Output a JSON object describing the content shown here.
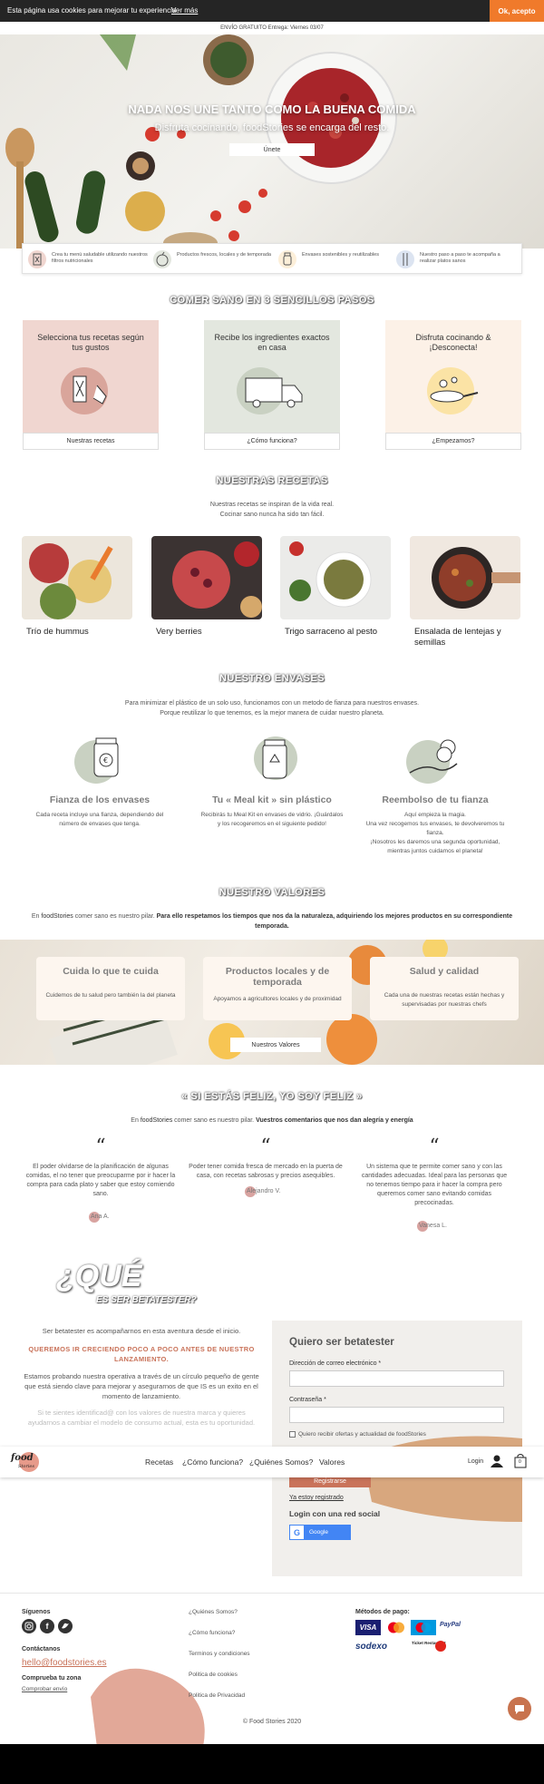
{
  "cookie": {
    "text": "Esta página usa cookies para mejorar tu experiencia",
    "link": "Ver más",
    "accept": "Ok, acepto"
  },
  "shipping": "ENVÍO GRATUITO Entrega: Viernes 03/07",
  "hero": {
    "title": "NADA NOS UNE TANTO COMO LA BUENA COMIDA",
    "subtitle": "Disfruta cocinando, foodStories se encarga del resto.",
    "button": "Únete"
  },
  "features": [
    {
      "text": "Crea tu menú saludable utilizando nuestros filtros nutricionales",
      "icon": "menu-filter-icon"
    },
    {
      "text": "Productos frescos, locales y de temporada",
      "icon": "fresh-produce-icon"
    },
    {
      "text": "Envases sostenibles y reutilizables",
      "icon": "reusable-jar-icon"
    },
    {
      "text": "Nuestro paso a paso te acompaña a realizar platos sanos",
      "icon": "cutlery-icon"
    }
  ],
  "steps": {
    "title": "COMER SANO EN 3 SENCILLOS PASOS",
    "items": [
      {
        "title": "Selecciona tus recetas según tus gustos",
        "button": "Nuestras recetas",
        "color": "#f0d6d0"
      },
      {
        "title": "Recibe los ingredientes exactos en casa",
        "button": "¿Cómo funciona?",
        "color": "#e3e7df"
      },
      {
        "title": "Disfruta cocinando & ¡Desconecta!",
        "button": "¿Empezamos?",
        "color": "#fcf1e7"
      }
    ]
  },
  "recipes": {
    "title": "NUESTRAS RECETAS",
    "intro1": "Nuestras recetas se inspiran de la vida real.",
    "intro2": "Cocinar sano nunca ha sido tan fácil.",
    "items": [
      {
        "name": "Trío de hummus"
      },
      {
        "name": "Very berries"
      },
      {
        "name": "Trigo sarraceno al pesto"
      },
      {
        "name": "Ensalada de lentejas y semillas"
      }
    ]
  },
  "envases": {
    "title": "NUESTRO ENVASES",
    "intro1": "Para minimizar el plástico de un solo uso, funcionamos con un metodo de fianza para nuestros envases.",
    "intro2": "Porque reutilizar lo que tenemos, es la mejor manera de cuidar nuestro planeta.",
    "items": [
      {
        "title": "Fianza de los envases",
        "desc": "Cada receta incluye una fianza, dependiendo del número de envases que tenga."
      },
      {
        "title": "Tu « Meal kit » sin plástico",
        "desc": "Recibirás tu Meal Kit en envases de vidrio. ¡Guárdalos y los recogeremos en el siguiente pedido!"
      },
      {
        "title": "Reembolso de tu fianza",
        "desc1": "Aquí empieza la magia.",
        "desc2": "Una vez recogemos tus envases, te devolveremos tu fianza.",
        "desc3": "¡Nosotros les daremos una segunda oportunidad, mientras juntos cuidamos el planeta!"
      }
    ]
  },
  "valores": {
    "title": "NUESTRO VALORES",
    "intro_a": "En ",
    "intro_brand": "foodStories",
    "intro_b": " comer sano es nuestro pilar. ",
    "intro_bold": "Para ello respetamos los tiempos que nos da la naturaleza, adquiriendo los mejores productos en su correspondiente temporada.",
    "items": [
      {
        "title": "Cuida lo que te cuida",
        "desc": "Cuidemos de tu salud pero también la del planeta"
      },
      {
        "title": "Productos locales y de temporada",
        "desc": "Apoyamos a agricultores locales y de proximidad"
      },
      {
        "title": "Salud y calidad",
        "desc": "Cada una de nuestras recetas están hechas y supervisadas por nuestras chefs"
      }
    ],
    "button": "Nuestros Valores"
  },
  "testimonials": {
    "title": "« SI ESTÁS FELIZ, YO SOY FELIZ »",
    "intro_a": "En ",
    "intro_brand": "foodStories",
    "intro_b": " comer sano es nuestro pilar. ",
    "intro_bold": "Vuestros comentarios que nos dan alegría y energía",
    "quote_mark": "“",
    "items": [
      {
        "text": "El poder olvidarse de la planificación de algunas comidas, el no tener que preocuparme por ir hacer la compra para cada plato y saber que estoy comiendo sano.",
        "author": "Ana A."
      },
      {
        "text": "Poder tener comida fresca de mercado en la puerta de casa, con recetas sabrosas y precios asequibles.",
        "author": "Alejandro V."
      },
      {
        "text": "Un sistema que te permite comer sano y con las cantidades adecuadas. Ideal para las personas que no tenemos tiempo para ir hacer la compra pero queremos comer sano evitando comidas precocinadas.",
        "author": "Vanesa L."
      }
    ]
  },
  "beta": {
    "title_big": "¿QUÉ",
    "title_small": "ES SER BETATESTER?",
    "p1": "Ser betatester es acompañarnos en esta aventura desde el inicio.",
    "p2": "QUEREMOS IR CRECIENDO POCO A POCO ANTES DE NUESTRO LANZAMIENTO.",
    "p3": "Estamos probando nuestra operativa a través de un círculo pequeño de gente que está siendo clave para mejorar y asegurarnos de que IS es un exito en el momento de lanzamiento.",
    "p4": "Si te sientes identificad@ con los valores de nuestra marca y quieres ayudarnos a cambiar el modelo de consumo actual, esta es tu oportunidad.",
    "form": {
      "title": "Quiero ser betatester",
      "email_label": "Dirección de correo electrónico *",
      "password_label": "Contraseña *",
      "checkbox_label": "Quiero recibir ofertas y actualidad de foodStories",
      "submit": "Registrarse",
      "already": "Ya estoy registrado",
      "social_title": "Login con una red social",
      "google": "Google"
    }
  },
  "navbar": {
    "logo": "food",
    "logo_sub": "Stories",
    "links": [
      "Recetas",
      "¿Cómo funciona?",
      "¿Quiénes Somos?",
      "Valores"
    ],
    "login": "Login",
    "cart_count": "0"
  },
  "footer": {
    "follow": "Síguenos",
    "contact": "Contáctanos",
    "email": "hello@foodstories.es",
    "zone": "Comprueba tu zona",
    "zone_link": "Comprobar envío",
    "links": [
      "¿Quiénes Somos?",
      "¿Cómo funciona?",
      "Terminos y condiciones",
      "Politica de cookies",
      "Politica de Privacidad"
    ],
    "payment_title": "Métodos de pago:",
    "payments": [
      "VISA",
      "PayPal",
      "sodexo",
      "Ticket Restaurant"
    ],
    "copyright": "© Food Stories 2020"
  }
}
